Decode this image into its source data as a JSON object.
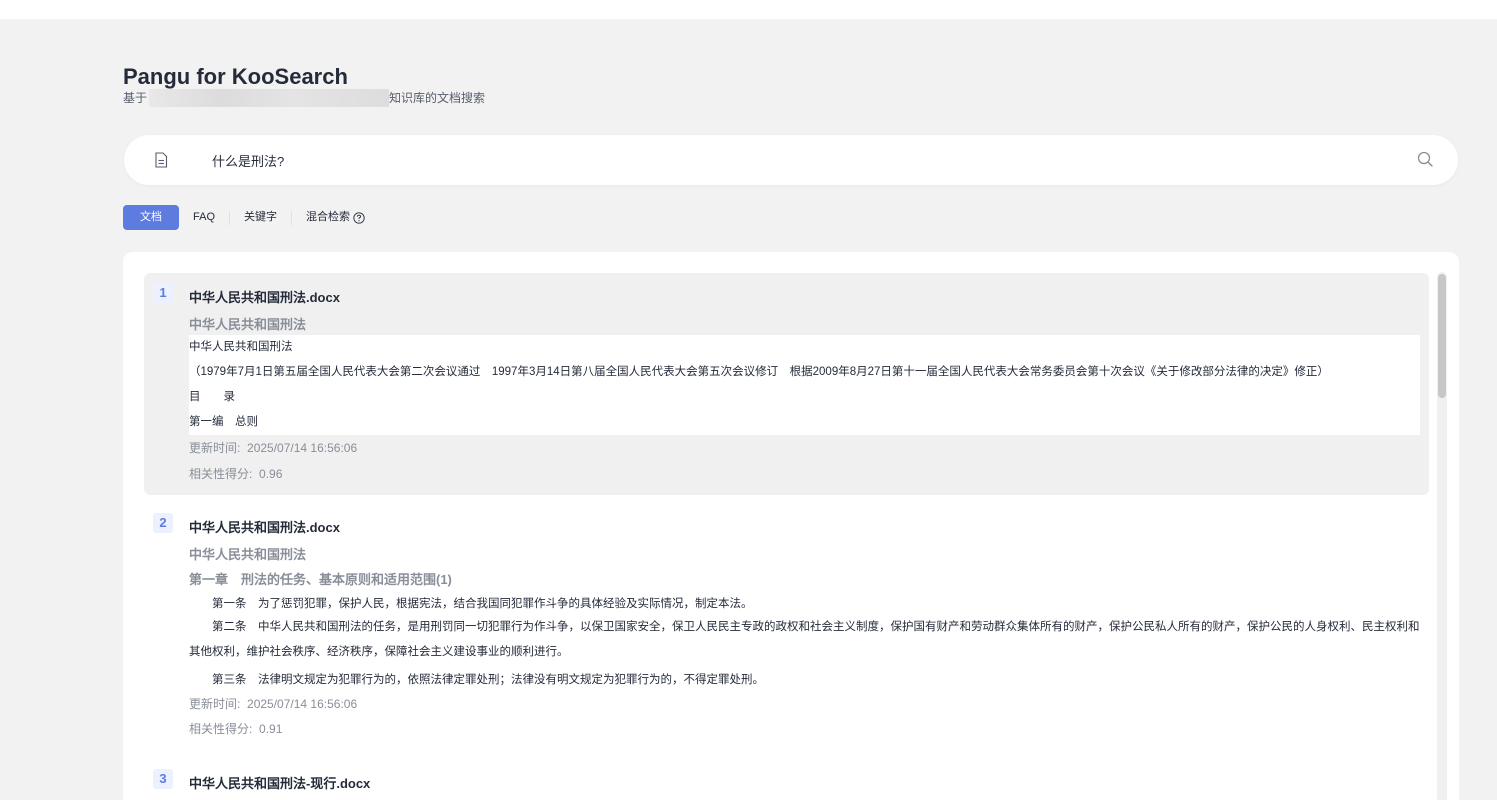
{
  "header": {
    "title": "Pangu for KooSearch",
    "subtitle_prefix": "基于",
    "subtitle_suffix": "知识库的文档搜索"
  },
  "search": {
    "value": "什么是刑法?",
    "placeholder": ""
  },
  "tabs": [
    {
      "label": "文档",
      "active": true
    },
    {
      "label": "FAQ",
      "active": false
    },
    {
      "label": "关键字",
      "active": false
    },
    {
      "label": "混合检索",
      "active": false
    }
  ],
  "labels": {
    "update_time": "更新时间:",
    "relevance": "相关性得分:"
  },
  "results": [
    {
      "rank": "1",
      "title": "中华人民共和国刑法.docx",
      "subtitle": "中华人民共和国刑法",
      "lines": [
        "中华人民共和国刑法",
        "（1979年7月1日第五届全国人民代表大会第二次会议通过　1997年3月14日第八届全国人民代表大会第五次会议修订　根据2009年8月27日第十一届全国人民代表大会常务委员会第十次会议《关于修改部分法律的决定》修正）",
        "目　　录",
        "第一编　总则"
      ],
      "update_time": "2025/07/14 16:56:06",
      "score": "0.96"
    },
    {
      "rank": "2",
      "title": "中华人民共和国刑法.docx",
      "subtitle": "中华人民共和国刑法",
      "chapter": "第一章　刑法的任务、基本原则和适用范围(1)",
      "lines": [
        "　　第一条　为了惩罚犯罪，保护人民，根据宪法，结合我国同犯罪作斗争的具体经验及实际情况，制定本法。",
        "　　第二条　中华人民共和国刑法的任务，是用刑罚同一切犯罪行为作斗争，以保卫国家安全，保卫人民民主专政的政权和社会主义制度，保护国有财产和劳动群众集体所有的财产，保护公民私人所有的财产，保护公民的人身权利、民主权利和其他权利，维护社会秩序、经济秩序，保障社会主义建设事业的顺利进行。",
        "　　第三条　法律明文规定为犯罪行为的，依照法律定罪处刑；法律没有明文规定为犯罪行为的，不得定罪处刑。"
      ],
      "update_time": "2025/07/14 16:56:06",
      "score": "0.91"
    },
    {
      "rank": "3",
      "title": "中华人民共和国刑法-现行.docx"
    }
  ],
  "colors": {
    "accent": "#5e7ce0",
    "background": "#f2f2f2"
  },
  "icons": [
    "document-icon",
    "search-icon",
    "help-circle-icon"
  ]
}
